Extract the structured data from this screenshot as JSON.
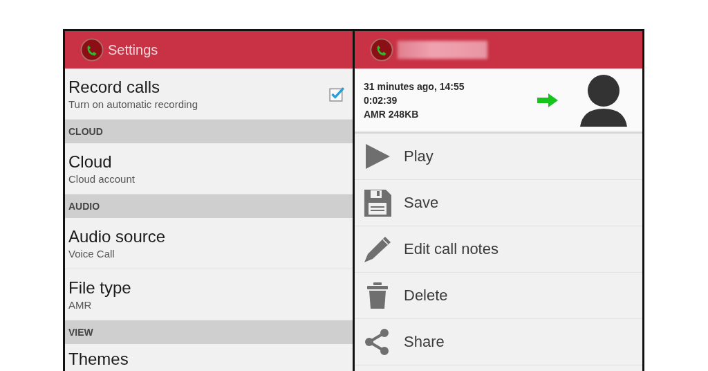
{
  "settings_screen": {
    "title": "Settings",
    "items": [
      {
        "kind": "checkbox",
        "title": "Record calls",
        "summary": "Turn on automatic recording",
        "checked": true
      },
      {
        "kind": "section",
        "title": "CLOUD"
      },
      {
        "kind": "setting",
        "title": "Cloud",
        "summary": "Cloud account"
      },
      {
        "kind": "section",
        "title": "AUDIO"
      },
      {
        "kind": "setting",
        "title": "Audio source",
        "summary": "Voice Call"
      },
      {
        "kind": "setting",
        "title": "File type",
        "summary": "AMR"
      },
      {
        "kind": "section",
        "title": "VIEW"
      },
      {
        "kind": "setting",
        "title": "Themes"
      }
    ]
  },
  "recording_screen": {
    "recording": {
      "time": "31 minutes ago, 14:55",
      "duration": "0:02:39",
      "format": "AMR 248KB",
      "outgoing": true
    },
    "actions": [
      {
        "kind": "play",
        "label": "Play"
      },
      {
        "kind": "save",
        "label": "Save"
      },
      {
        "kind": "edit",
        "label": "Edit call notes"
      },
      {
        "kind": "delete",
        "label": "Delete"
      },
      {
        "kind": "share",
        "label": "Share"
      }
    ]
  }
}
